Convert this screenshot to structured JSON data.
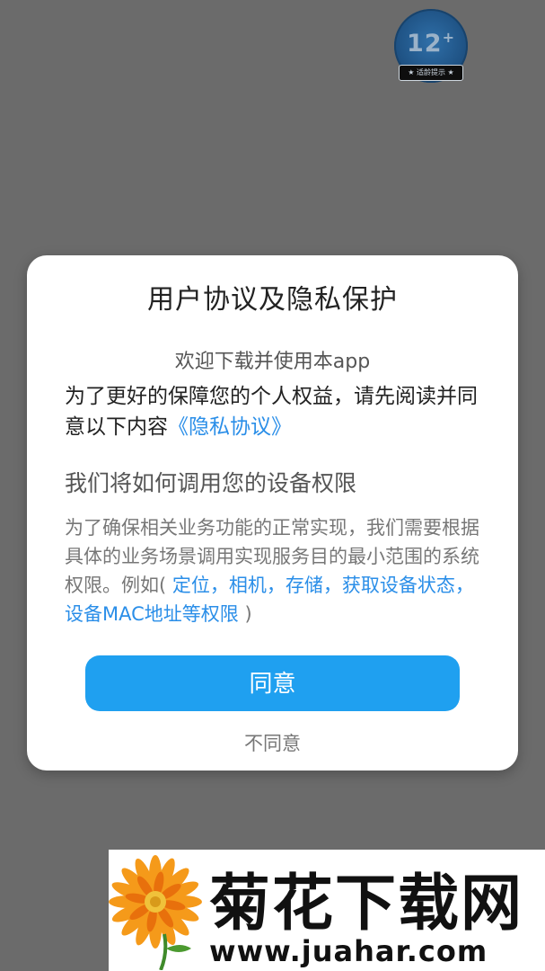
{
  "age_badge": {
    "rating": "12",
    "plus": "+",
    "caption": "★ 适龄提示 ★"
  },
  "dialog": {
    "title": "用户协议及隐私保护",
    "welcome": "欢迎下载并使用本app",
    "intro_text": "为了更好的保障您的个人权益，请先阅读并同意以下内容",
    "privacy_link": "《隐私协议》",
    "permissions_heading": "我们将如何调用您的设备权限",
    "permissions_text": "为了确保相关业务功能的正常实现，我们需要根据具体的业务场景调用实现服务目的最小范围的系统权限。例如(",
    "permissions_examples": " 定位，相机，存储，获取设备状态，设备MAC地址等权限",
    "permissions_close": " )",
    "agree_label": "同意",
    "disagree_label": "不同意"
  },
  "watermark": {
    "site_name": "菊花下载网",
    "url": "www.juahar.com"
  },
  "colors": {
    "overlay": "#6b6b6b",
    "accent": "#1fa0f0",
    "link": "#2a8ee8"
  }
}
